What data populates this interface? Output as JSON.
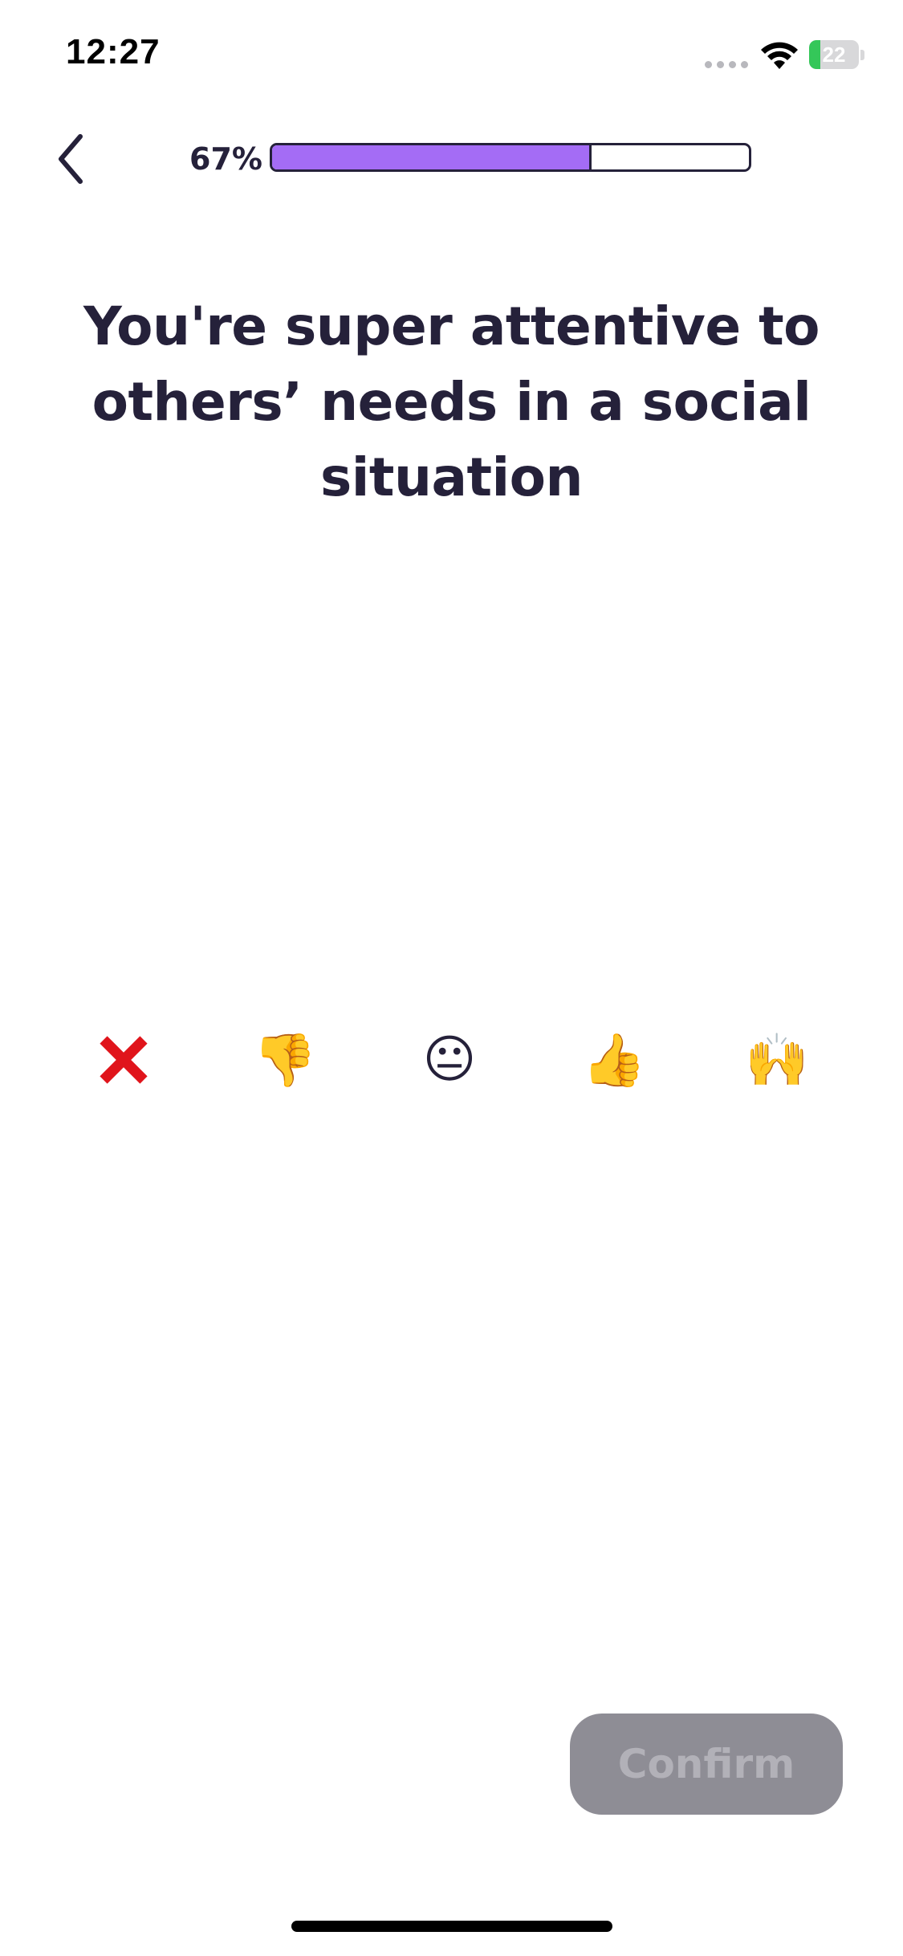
{
  "status_bar": {
    "time": "12:27",
    "battery_level": "22",
    "battery_fraction": 0.22
  },
  "header": {
    "back_icon": "chevron-left-icon",
    "progress_label": "67%",
    "progress_fraction": 0.67,
    "progress_color": "#a46cf5"
  },
  "question": {
    "text": "You're super attentive to others’ needs in a social situation"
  },
  "options": [
    {
      "icon": "cross-mark-icon",
      "glyph": "❌"
    },
    {
      "icon": "thumbs-down-icon",
      "glyph": "👎"
    },
    {
      "icon": "neutral-face-icon",
      "glyph": "😐"
    },
    {
      "icon": "thumbs-up-icon",
      "glyph": "👍"
    },
    {
      "icon": "raising-hands-icon",
      "glyph": "🙌"
    }
  ],
  "footer": {
    "confirm_label": "Confirm",
    "confirm_color": "#8e8d95"
  }
}
